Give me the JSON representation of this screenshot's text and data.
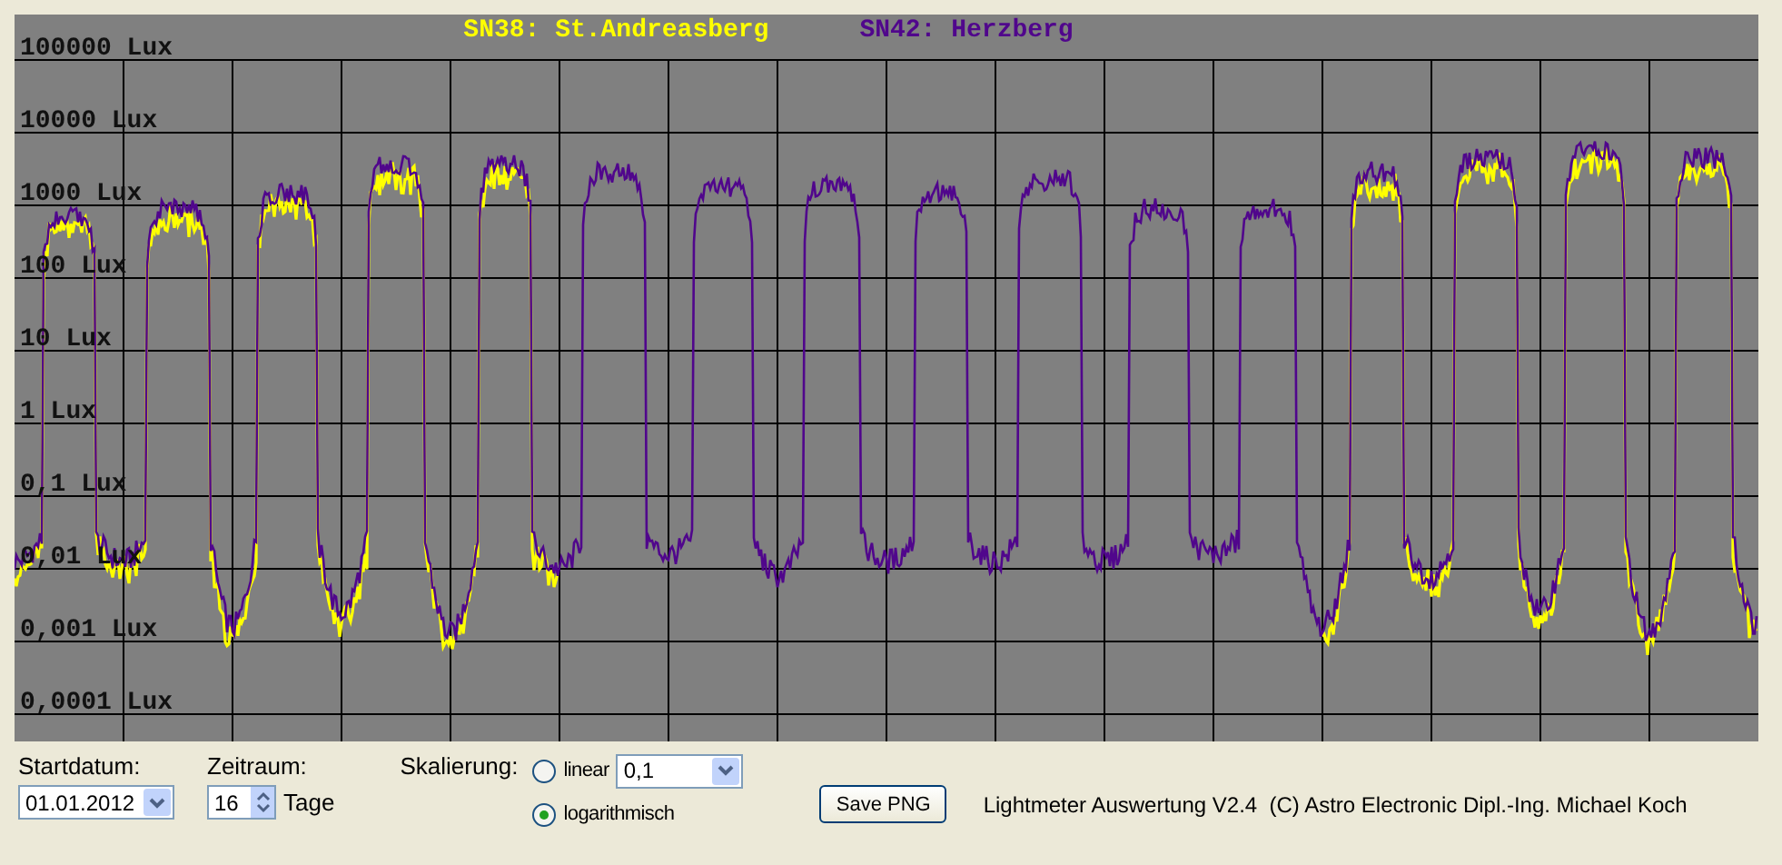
{
  "chart": {
    "legend": [
      {
        "label": "SN38: St.Andreasberg",
        "color": "#ffff00"
      },
      {
        "label": "SN42: Herzberg",
        "color": "#50068c"
      }
    ],
    "y_axis_labels": [
      "100000 Lux",
      "10000 Lux",
      "1000 Lux",
      "100 Lux",
      "10 Lux",
      "1 Lux",
      "0,1 Lux",
      "0,01 Lux",
      "0,001 Lux",
      "0,0001 Lux"
    ]
  },
  "controls": {
    "start_date": {
      "label": "Startdatum:",
      "value": "01.01.2012"
    },
    "period": {
      "label": "Zeitraum:",
      "value": "16",
      "unit": "Tage"
    },
    "scaling": {
      "label": "Skalierung:",
      "options": [
        {
          "label": "linear",
          "selected": false
        },
        {
          "label": "logarithmisch",
          "selected": true
        }
      ],
      "linear_value": "0,1"
    },
    "save_button": "Save PNG"
  },
  "credit": "Lightmeter Auswertung V2.4  (C) Astro Electronic Dipl.-Ing. Michael Koch"
}
